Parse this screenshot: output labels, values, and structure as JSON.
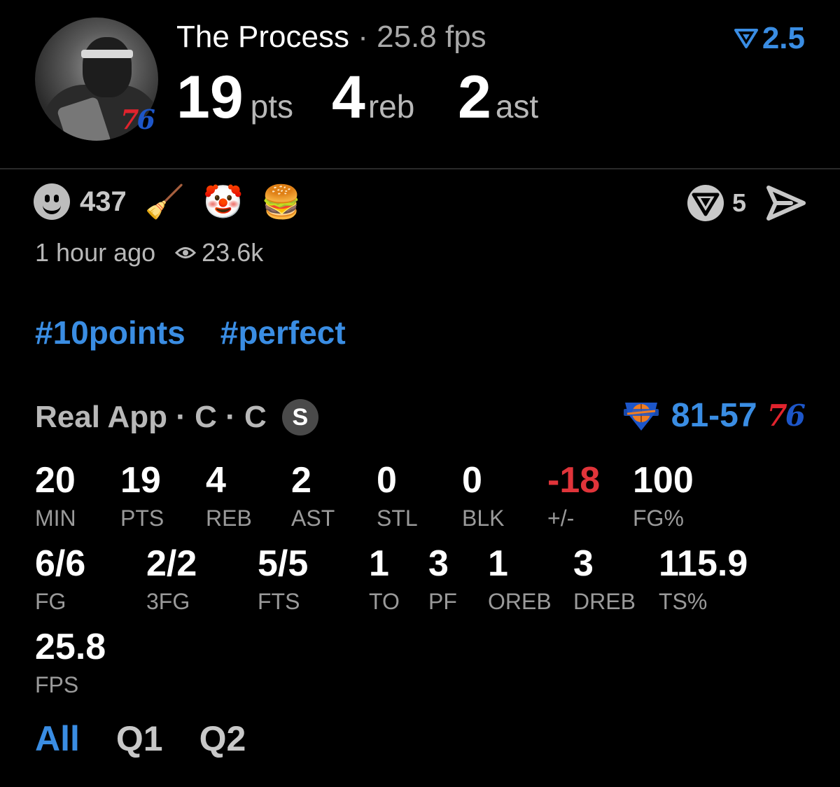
{
  "player": {
    "name": "The Process",
    "separator": "·",
    "fps": "25.8 fps",
    "pts": "19",
    "pts_unit": "pts",
    "reb": "4",
    "reb_unit": "reb",
    "ast": "2",
    "ast_unit": "ast",
    "team_badge": {
      "a": "7",
      "b": "6"
    }
  },
  "line": {
    "icon": "line-arrow-icon",
    "value": "2.5"
  },
  "reactions": {
    "smiley_count": "437",
    "emojis": [
      {
        "name": "broom-emoji",
        "char": "🧹"
      },
      {
        "name": "clown-emoji",
        "char": "🤡"
      },
      {
        "name": "burger-emoji",
        "char": "🍔"
      }
    ],
    "vote_count": "5"
  },
  "meta": {
    "time": "1 hour ago",
    "views": "23.6k"
  },
  "hashtags": [
    "#10points",
    "#perfect"
  ],
  "game": {
    "source": "Real App · C · C",
    "badge": "S",
    "score": "81-57"
  },
  "stats_row1": [
    {
      "value": "20",
      "label": "MIN"
    },
    {
      "value": "19",
      "label": "PTS"
    },
    {
      "value": "4",
      "label": "REB"
    },
    {
      "value": "2",
      "label": "AST"
    },
    {
      "value": "0",
      "label": "STL"
    },
    {
      "value": "0",
      "label": "BLK"
    },
    {
      "value": "-18",
      "label": "+/-"
    },
    {
      "value": "100",
      "label": "FG%"
    }
  ],
  "stats_row2": [
    {
      "value": "6/6",
      "label": "FG"
    },
    {
      "value": "2/2",
      "label": "3FG"
    },
    {
      "value": "5/5",
      "label": "FTS"
    },
    {
      "value": "1",
      "label": "TO"
    },
    {
      "value": "3",
      "label": "PF"
    },
    {
      "value": "1",
      "label": "OREB"
    },
    {
      "value": "3",
      "label": "DREB"
    },
    {
      "value": "115.9",
      "label": "TS%"
    }
  ],
  "stats_row3": [
    {
      "value": "25.8",
      "label": "FPS"
    }
  ],
  "tabs": [
    "All",
    "Q1",
    "Q2"
  ],
  "colors": {
    "accent": "#3a8de3",
    "negative": "#e0343a",
    "sixers_red": "#e0232d",
    "sixers_blue": "#1d56c9"
  }
}
